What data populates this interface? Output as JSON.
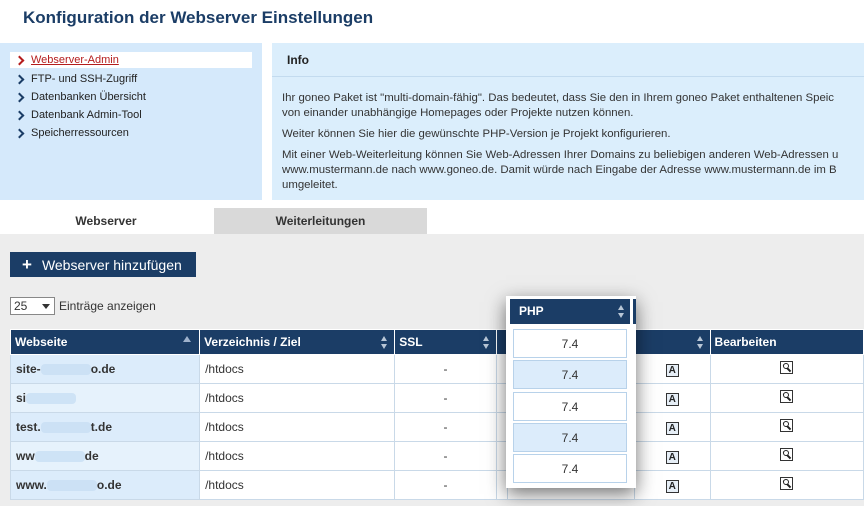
{
  "page": {
    "title": "Konfiguration der Webserver Einstellungen"
  },
  "nav": {
    "items": [
      {
        "label": "Webserver-Admin",
        "active": true
      },
      {
        "label": "FTP- und SSH-Zugriff"
      },
      {
        "label": "Datenbanken Übersicht"
      },
      {
        "label": "Datenbank Admin-Tool"
      },
      {
        "label": "Speicherressourcen"
      }
    ]
  },
  "info": {
    "title": "Info",
    "p1_l1": "Ihr goneo Paket ist \"multi-domain-fähig\". Das bedeutet, dass Sie den in Ihrem goneo Paket enthaltenen Speic",
    "p1_l2": "von einander unabhängige Homepages oder Projekte nutzen können.",
    "p2": "Weiter können Sie hier die gewünschte PHP-Version je Projekt konfigurieren.",
    "p3_l1": "Mit einer Web-Weiterleitung können Sie Web-Adressen Ihrer Domains zu beliebigen anderen Web-Adressen u",
    "p3_l2": "www.mustermann.de nach www.goneo.de. Damit würde nach Eingabe der Adresse www.mustermann.de im B",
    "p3_l3": "umgeleitet."
  },
  "tabs": {
    "webserver": "Webserver",
    "weiterleitungen": "Weiterleitungen"
  },
  "toolbar": {
    "add_label": "Webserver hinzufügen",
    "page_size": "25",
    "page_size_label": "Einträge anzeigen"
  },
  "table": {
    "headers": {
      "site": "Webseite",
      "dir": "Verzeichnis / Ziel",
      "ssl": "SSL",
      "php": "PHP",
      "edit": "Bearbeiten"
    },
    "rows": [
      {
        "site_a": "site-",
        "site_b": "o.de",
        "dir": "/htdocs",
        "ssl": "-",
        "php": "7.4"
      },
      {
        "site_a": "si",
        "site_b": "",
        "dir": "/htdocs",
        "ssl": "-",
        "php": "7.4"
      },
      {
        "site_a": "test.",
        "site_b": "t.de",
        "dir": "/htdocs",
        "ssl": "-",
        "php": "7.4"
      },
      {
        "site_a": "ww",
        "site_b": "de",
        "dir": "/htdocs",
        "ssl": "-",
        "php": "7.4"
      },
      {
        "site_a": "www.",
        "site_b": "o.de",
        "dir": "/htdocs",
        "ssl": "-",
        "php": "7.4"
      }
    ]
  },
  "icons": {
    "app": "a-icon",
    "edit": "wrench-icon"
  },
  "colors": {
    "primary": "#1b3d66",
    "nav_bg": "#d5e9fb",
    "active": "#b51c1c"
  }
}
